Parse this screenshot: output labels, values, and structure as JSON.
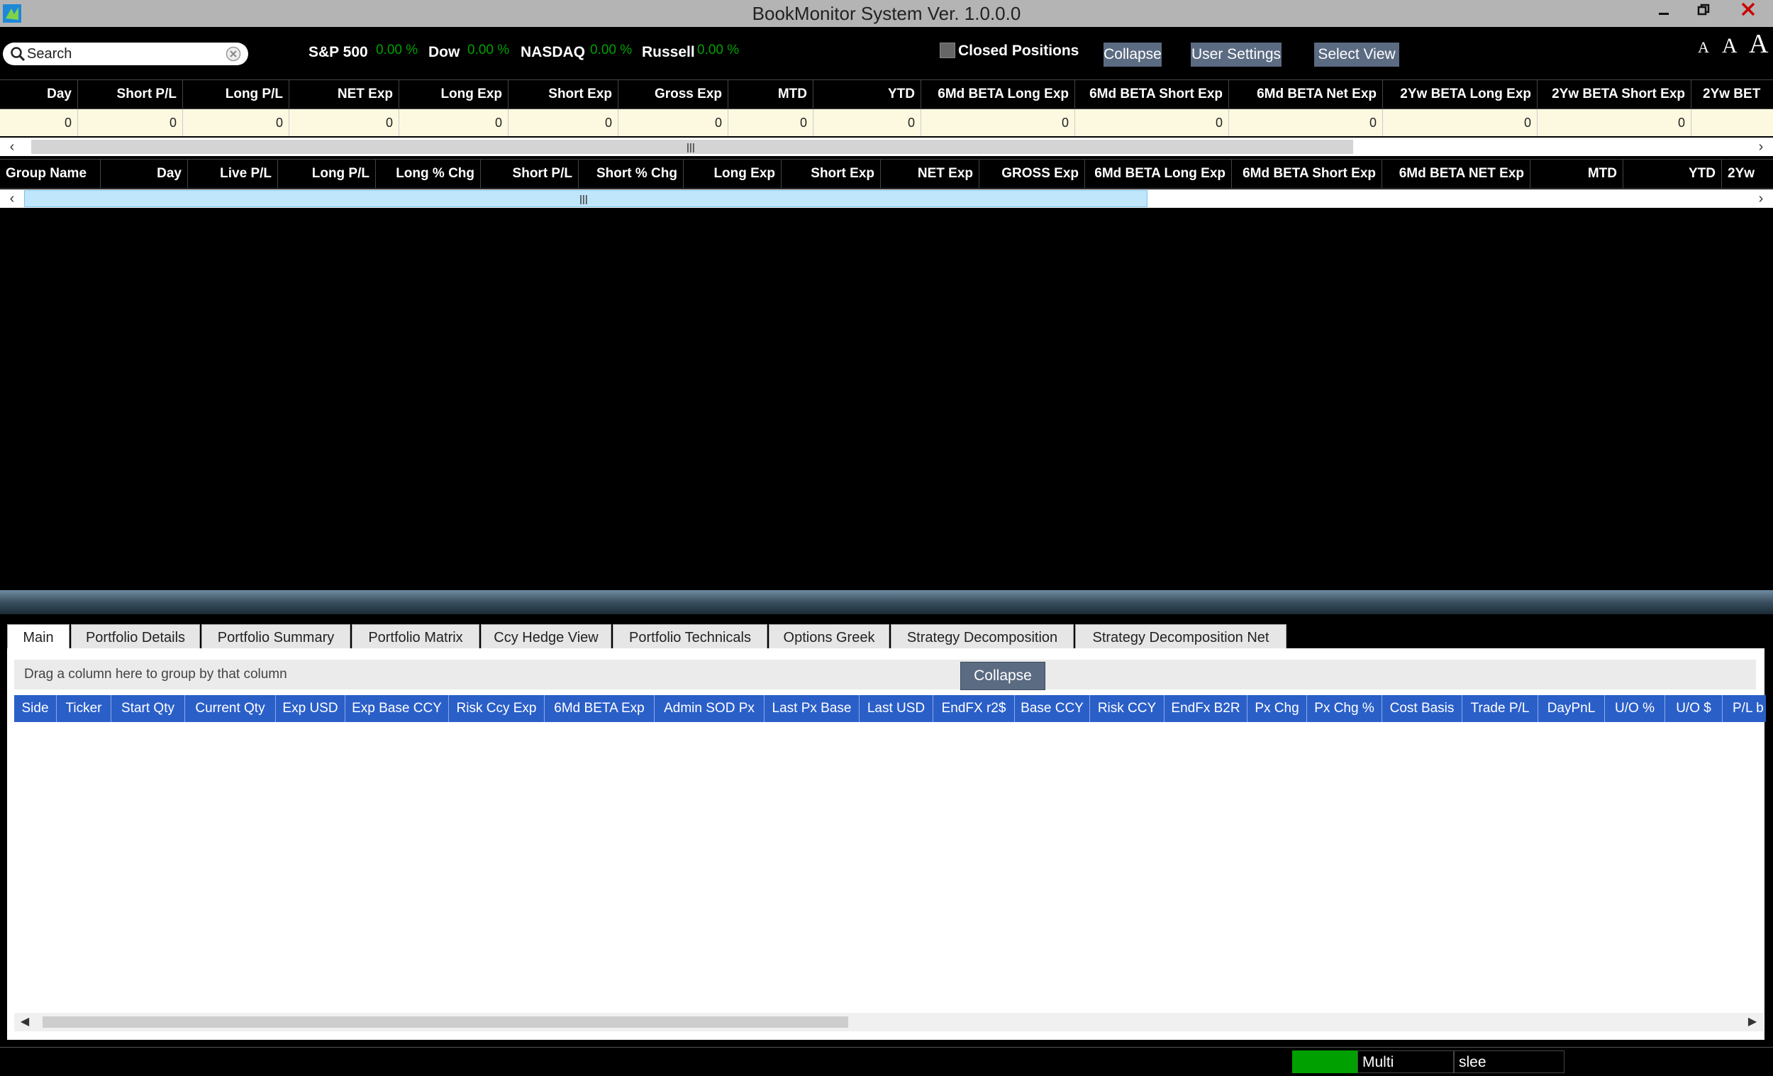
{
  "window": {
    "title": "BookMonitor System Ver. 1.0.0.0"
  },
  "search": {
    "placeholder": "Search"
  },
  "indices": [
    {
      "name": "S&P 500",
      "value": "0.00 %"
    },
    {
      "name": "Dow",
      "value": "0.00 %"
    },
    {
      "name": "NASDAQ",
      "value": "0.00 %"
    },
    {
      "name": "Russell",
      "value": "0.00 %"
    }
  ],
  "toolbar": {
    "closed_positions_label": "Closed Positions",
    "collapse_label": "Collapse",
    "user_settings_label": "User Settings",
    "select_view_label": "Select View",
    "font_small": "A",
    "font_medium": "A",
    "font_large": "A"
  },
  "summary": {
    "headers": [
      "Day",
      "Short P/L",
      "Long P/L",
      "NET Exp",
      "Long Exp",
      "Short Exp",
      "Gross Exp",
      "MTD",
      "YTD",
      "6Md BETA Long Exp",
      "6Md BETA Short Exp",
      "6Md BETA Net Exp",
      "2Yw BETA Long Exp",
      "2Yw BETA Short Exp",
      "2Yw BET"
    ],
    "values": [
      "0",
      "0",
      "0",
      "0",
      "0",
      "0",
      "0",
      "0",
      "0",
      "0",
      "0",
      "0",
      "0",
      "0",
      ""
    ]
  },
  "groups": {
    "headers": [
      "Group Name",
      "Day",
      "Live P/L",
      "Long P/L",
      "Long % Chg",
      "Short P/L",
      "Short % Chg",
      "Long Exp",
      "Short Exp",
      "NET Exp",
      "GROSS Exp",
      "6Md BETA Long Exp",
      "6Md BETA Short Exp",
      "6Md BETA NET Exp",
      "MTD",
      "YTD",
      "2Yw"
    ]
  },
  "tabs": [
    "Main",
    "Portfolio Details",
    "Portfolio Summary",
    "Portfolio Matrix",
    "Ccy Hedge View",
    "Portfolio Technicals",
    "Options Greek",
    "Strategy Decomposition",
    "Strategy Decomposition Net"
  ],
  "positions": {
    "group_hint": "Drag a column here to group by that column",
    "collapse_label": "Collapse",
    "headers": [
      "Side",
      "Ticker",
      "Start Qty",
      "Current Qty",
      "Exp USD",
      "Exp Base CCY",
      "Risk Ccy Exp",
      "6Md BETA Exp",
      "Admin SOD Px",
      "Last Px Base",
      "Last USD",
      "EndFX r2$",
      "Base CCY",
      "Risk CCY",
      "EndFx B2R",
      "Px Chg",
      "Px Chg %",
      "Cost Basis",
      "Trade P/L",
      "DayPnL",
      "U/O %",
      "U/O $",
      "P/L b"
    ]
  },
  "status": {
    "mode": "Multi",
    "user": "slee",
    "indicator_color": "#00a000"
  },
  "colors": {
    "accent": "#5b6b82",
    "header_blue": "#2b5fc8",
    "index_green": "#00a000",
    "value_row": "#fcf9e0"
  }
}
